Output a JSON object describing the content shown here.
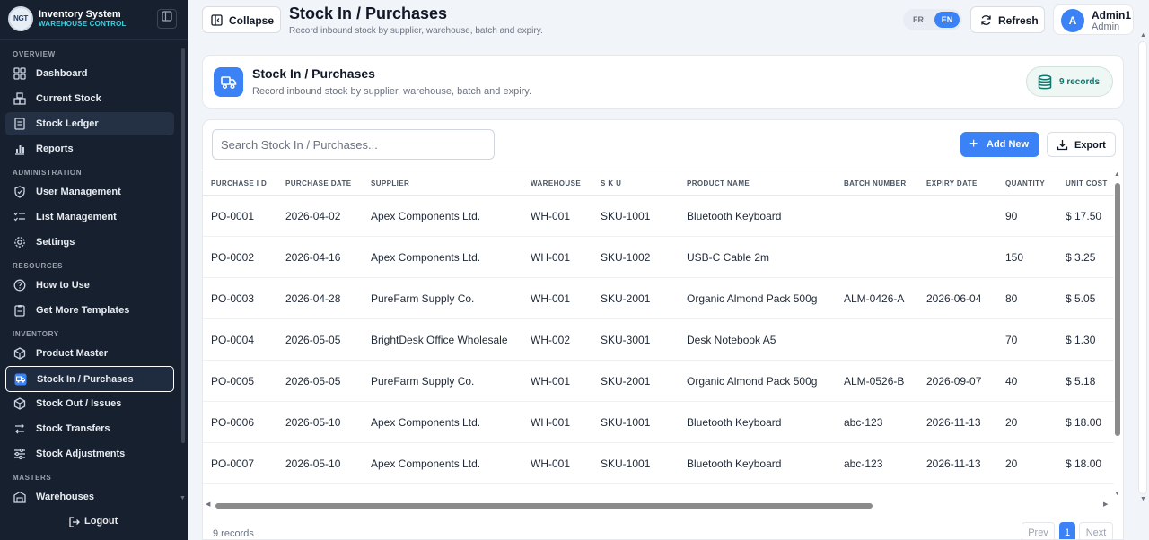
{
  "brand": {
    "logo_text": "NGT",
    "title": "Inventory System",
    "subtitle": "WAREHOUSE CONTROL"
  },
  "sidebar": {
    "sections": {
      "overview": "OVERVIEW",
      "administration": "ADMINISTRATION",
      "resources": "RESOURCES",
      "inventory": "INVENTORY",
      "masters": "MASTERS"
    },
    "items": {
      "dashboard": "Dashboard",
      "current_stock": "Current Stock",
      "stock_ledger": "Stock Ledger",
      "reports": "Reports",
      "user_management": "User Management",
      "list_management": "List Management",
      "settings": "Settings",
      "how_to_use": "How to Use",
      "templates": "Get More Templates",
      "product_master": "Product Master",
      "stock_in": "Stock In / Purchases",
      "stock_out": "Stock Out / Issues",
      "stock_transfers": "Stock Transfers",
      "stock_adjustments": "Stock Adjustments",
      "warehouses": "Warehouses"
    },
    "logout": "Logout"
  },
  "header": {
    "collapse": "Collapse",
    "title": "Stock In / Purchases",
    "subtitle": "Record inbound stock by supplier, warehouse, batch and expiry.",
    "lang_fr": "FR",
    "lang_en": "EN",
    "refresh": "Refresh",
    "avatar_initial": "A",
    "user_name": "Admin1",
    "user_role": "Admin"
  },
  "page": {
    "title": "Stock In / Purchases",
    "subtitle": "Record inbound stock by supplier, warehouse, batch and expiry.",
    "records_badge": "9 records"
  },
  "toolbar": {
    "search_placeholder": "Search Stock In / Purchases...",
    "add_new": "Add New",
    "export": "Export"
  },
  "table": {
    "columns": [
      "PURCHASE I D",
      "PURCHASE DATE",
      "SUPPLIER",
      "WAREHOUSE",
      "S K U",
      "PRODUCT NAME",
      "BATCH NUMBER",
      "EXPIRY DATE",
      "QUANTITY",
      "UNIT COST"
    ],
    "rows": [
      [
        "PO-0001",
        "2026-04-02",
        "Apex Components Ltd.",
        "WH-001",
        "SKU-1001",
        "Bluetooth Keyboard",
        "",
        "",
        "90",
        "$ 17.50"
      ],
      [
        "PO-0002",
        "2026-04-16",
        "Apex Components Ltd.",
        "WH-001",
        "SKU-1002",
        "USB-C Cable 2m",
        "",
        "",
        "150",
        "$ 3.25"
      ],
      [
        "PO-0003",
        "2026-04-28",
        "PureFarm Supply Co.",
        "WH-001",
        "SKU-2001",
        "Organic Almond Pack 500g",
        "ALM-0426-A",
        "2026-06-04",
        "80",
        "$ 5.05"
      ],
      [
        "PO-0004",
        "2026-05-05",
        "BrightDesk Office Wholesale",
        "WH-002",
        "SKU-3001",
        "Desk Notebook A5",
        "",
        "",
        "70",
        "$ 1.30"
      ],
      [
        "PO-0005",
        "2026-05-05",
        "PureFarm Supply Co.",
        "WH-001",
        "SKU-2001",
        "Organic Almond Pack 500g",
        "ALM-0526-B",
        "2026-09-07",
        "40",
        "$ 5.18"
      ],
      [
        "PO-0006",
        "2026-05-10",
        "Apex Components Ltd.",
        "WH-001",
        "SKU-1001",
        "Bluetooth Keyboard",
        "abc-123",
        "2026-11-13",
        "20",
        "$ 18.00"
      ],
      [
        "PO-0007",
        "2026-05-10",
        "Apex Components Ltd.",
        "WH-001",
        "SKU-1001",
        "Bluetooth Keyboard",
        "abc-123",
        "2026-11-13",
        "20",
        "$ 18.00"
      ]
    ]
  },
  "footer": {
    "count": "9 records",
    "prev": "Prev",
    "page": "1",
    "next": "Next"
  },
  "colors": {
    "accent": "#3b82f6",
    "sidebar_bg": "#17202e",
    "brand_sub": "#3ecfe0",
    "badge_text": "#0f766e"
  }
}
